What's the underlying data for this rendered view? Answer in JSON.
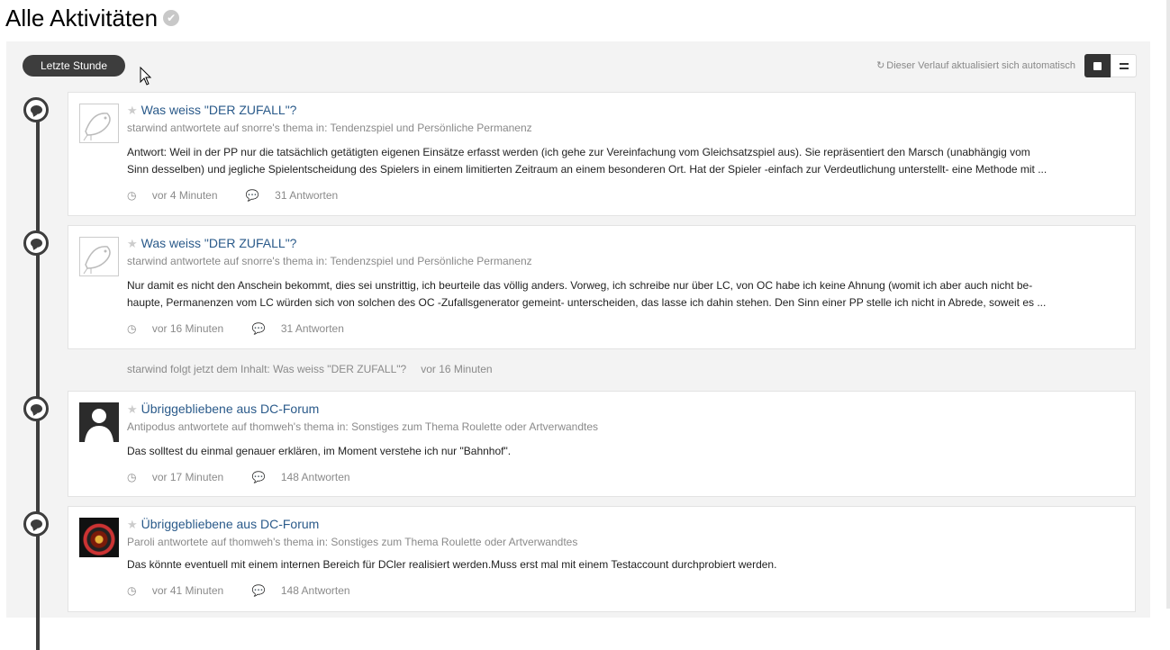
{
  "header": {
    "title": "Alle Aktivitäten",
    "check_icon": "check-circle-icon"
  },
  "filter": {
    "period_label": "Letzte Stunde"
  },
  "toolbar": {
    "auto_update_text": "Dieser Verlauf aktualisiert sich automatisch",
    "view_options": [
      "expanded-view-icon",
      "condensed-view-icon"
    ]
  },
  "items": [
    {
      "title": "Was weiss \"DER ZUFALL\"?",
      "meta": "starwind antwortete auf snorre's thema in: Tendenzspiel und Persönliche Permanenz",
      "snippet_line1": "Antwort: Weil in der PP nur die tatsächlich getätigten eigenen Einsätze erfasst werden (ich gehe zur Vereinfachung vom Gleichsatzspiel aus). Sie repräsentiert den Marsch (unabhängig vom",
      "snippet_line2": "Sinn desselben) und jegliche Spielentscheidung des Spielers in einem limitierten Zeitraum an einem besonderen Ort. Hat der Spieler -einfach zur Verdeutlichung unterstellt- eine Methode mit ...",
      "time": "vor 4 Minuten",
      "replies": "31 Antworten"
    },
    {
      "title": "Was weiss \"DER ZUFALL\"?",
      "meta": "starwind antwortete auf snorre's thema in: Tendenzspiel und Persönliche Permanenz",
      "snippet_line1": "Nur damit es nicht den Anschein bekommt, dies sei unstrittig, ich beurteile das völlig anders. Vorweg, ich schreibe nur über LC, von OC habe ich keine Ahnung (womit ich aber auch nicht be-",
      "snippet_line2": "haupte, Permanenzen vom LC würden sich von solchen des OC -Zufallsgenerator gemeint- unterscheiden, das lasse ich dahin stehen. Den Sinn einer PP stelle ich nicht in Abrede, soweit es ...",
      "time": "vor 16 Minuten",
      "replies": "31 Antworten"
    },
    {
      "title": "Übriggebliebene aus DC-Forum",
      "meta": "Antipodus antwortete auf thomweh's thema in: Sonstiges zum Thema Roulette oder Artverwandtes",
      "snippet_line1": "Das solltest du einmal genauer erklären, im Moment verstehe ich nur \"Bahnhof\".",
      "time": "vor 17 Minuten",
      "replies": "148 Antworten"
    },
    {
      "title": "Übriggebliebene aus DC-Forum",
      "meta": "Paroli antwortete auf thomweh's thema in: Sonstiges zum Thema Roulette oder Artverwandtes",
      "snippet_line1": "Das könnte eventuell mit einem internen Bereich für DCler realisiert werden.Muss erst mal mit einem Testaccount durchprobiert werden.",
      "time": "vor 41 Minuten",
      "replies": "148 Antworten"
    }
  ],
  "follow": {
    "text": "starwind folgt jetzt dem Inhalt: Was weiss \"DER ZUFALL\"?",
    "time": "vor 16 Minuten"
  },
  "icons": {
    "star": "star-icon",
    "clock": "clock-icon",
    "comment": "comment-icon",
    "refresh": "refresh-icon"
  }
}
